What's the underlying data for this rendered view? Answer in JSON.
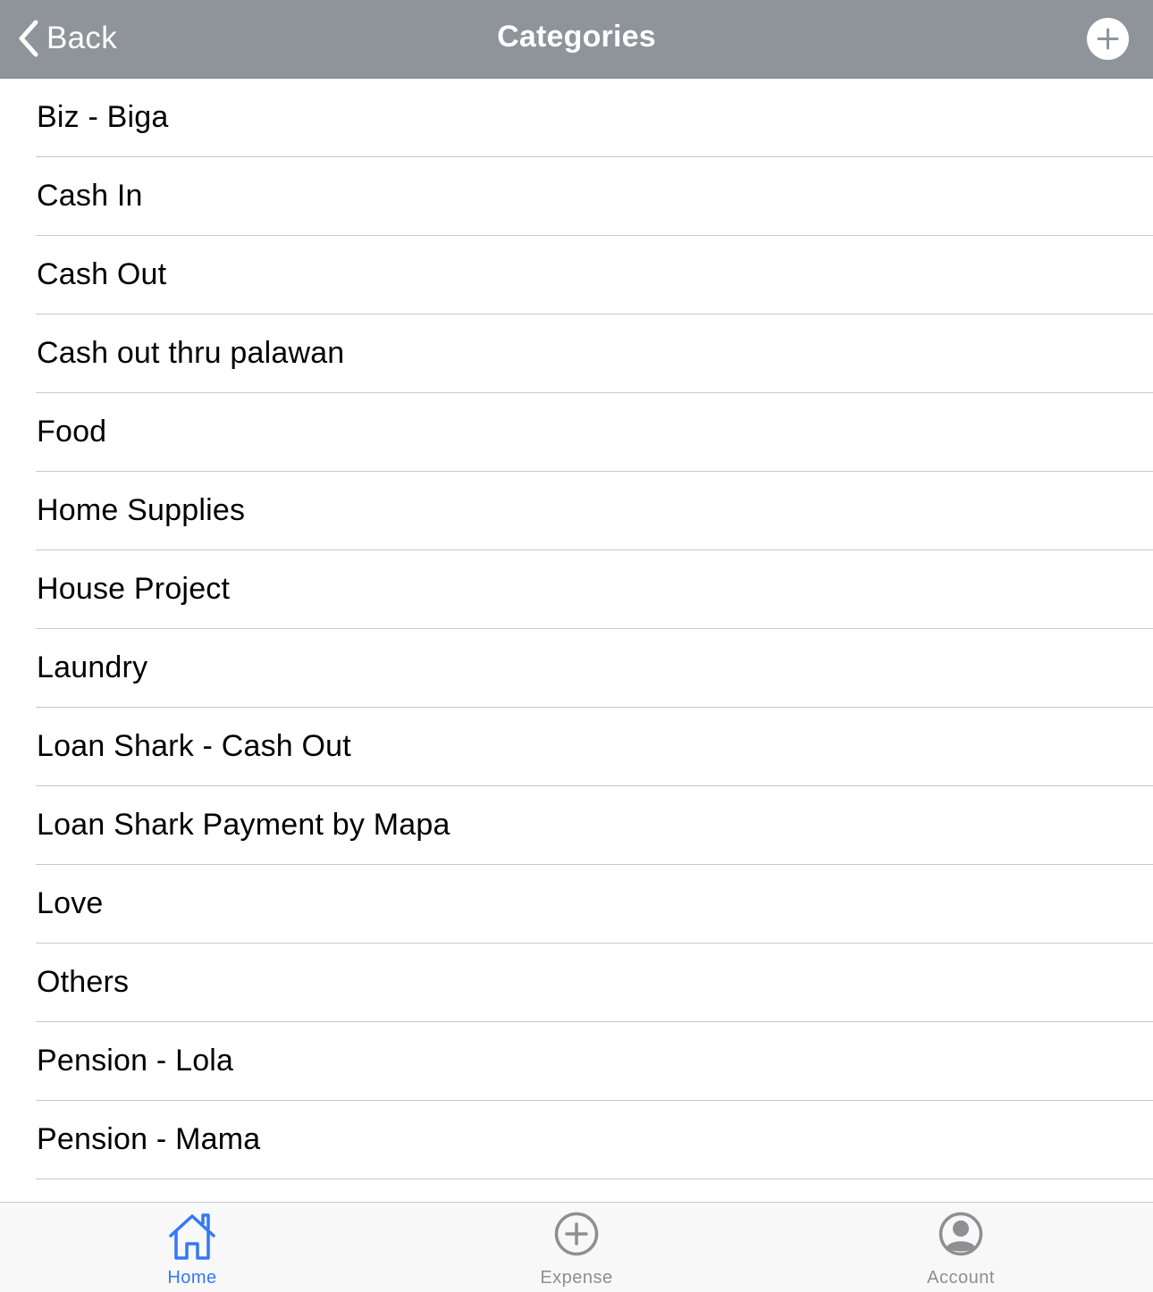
{
  "navbar": {
    "back_label": "Back",
    "title": "Categories",
    "back_icon": "chevron-left-icon",
    "add_icon": "plus-circle-icon",
    "background": "#8f939a"
  },
  "categories": [
    "Biz - Biga",
    "Cash In",
    "Cash Out",
    "Cash out thru palawan",
    "Food",
    "Home Supplies",
    "House Project",
    "Laundry",
    "Loan Shark - Cash Out",
    "Loan Shark Payment by Mapa",
    "Love",
    "Others",
    "Pension - Lola",
    "Pension - Mama"
  ],
  "tabbar": {
    "active_color": "#3478f6",
    "inactive_color": "#8e8e93",
    "tabs": [
      {
        "label": "Home",
        "icon": "home-icon",
        "active": true
      },
      {
        "label": "Expense",
        "icon": "plus-circle-icon",
        "active": false
      },
      {
        "label": "Account",
        "icon": "account-icon",
        "active": false
      }
    ]
  }
}
